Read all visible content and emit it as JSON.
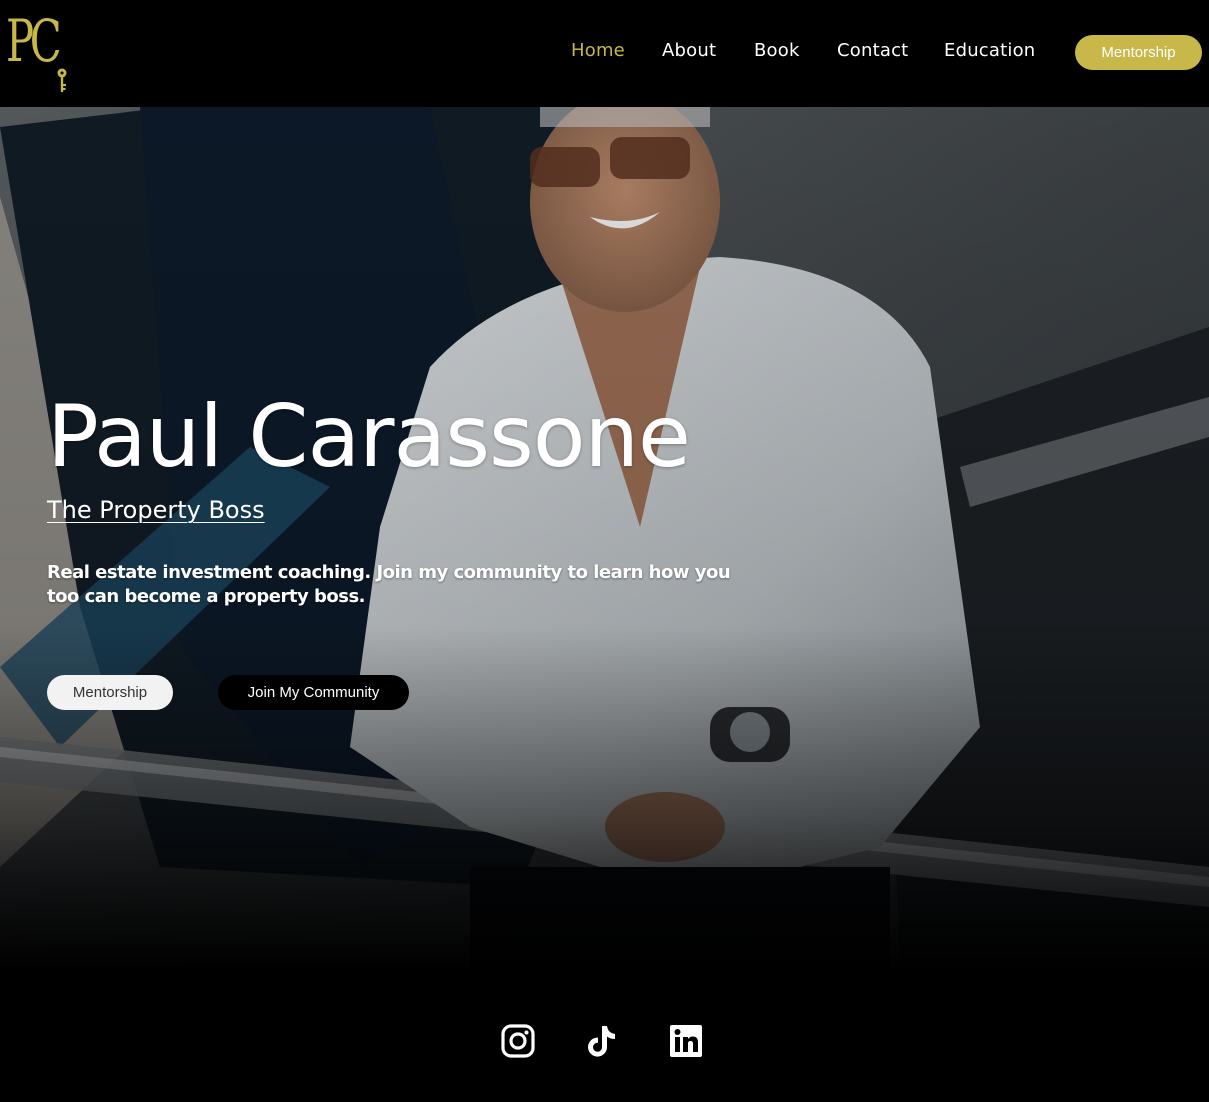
{
  "brand": {
    "logo_text": "PC",
    "logo_color": "#c8b84a"
  },
  "nav": {
    "items": [
      {
        "label": "Home",
        "active": true
      },
      {
        "label": "About",
        "active": false
      },
      {
        "label": "Book",
        "active": false
      },
      {
        "label": "Contact",
        "active": false
      },
      {
        "label": "Education",
        "active": false
      }
    ],
    "cta_label": "Mentorship"
  },
  "hero": {
    "title": "Paul Carassone",
    "subtitle": "The Property Boss",
    "description": "Real estate investment coaching. Join my community to learn how you too can become a property boss.",
    "primary_button": "Mentorship",
    "secondary_button": "Join My Community",
    "image_alt": "Smiling man in white linen shirt and sunglasses leaning on a yacht railing"
  },
  "social": {
    "icons": [
      "instagram-icon",
      "tiktok-icon",
      "linkedin-icon"
    ]
  },
  "colors": {
    "accent": "#c8b84a",
    "background": "#000000",
    "text": "#ffffff"
  }
}
